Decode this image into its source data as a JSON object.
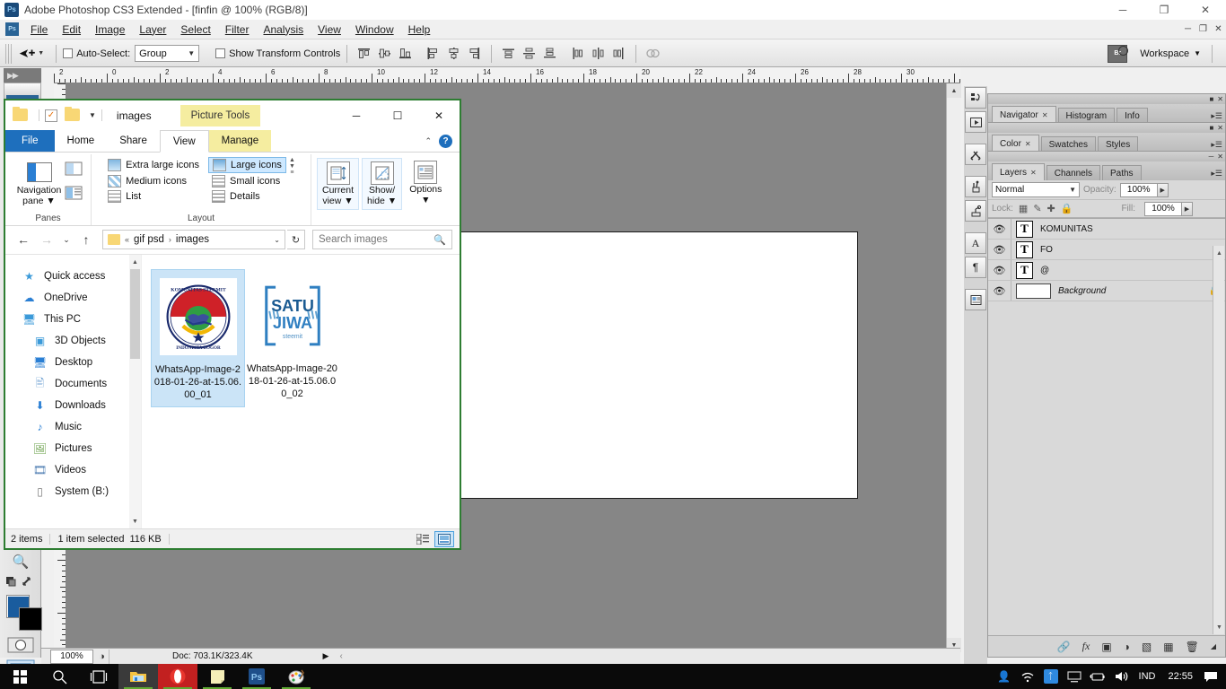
{
  "photoshop": {
    "title": "Adobe Photoshop CS3 Extended - [finfin @ 100% (RGB/8)]",
    "app_icon": "photoshop-icon",
    "window_buttons": {
      "minimize": "─",
      "maximize": "❐",
      "close": "✕"
    },
    "doc_buttons": {
      "minimize": "─",
      "restore": "❐",
      "close": "✕"
    },
    "menu": [
      {
        "label": "File"
      },
      {
        "label": "Edit"
      },
      {
        "label": "Image"
      },
      {
        "label": "Layer"
      },
      {
        "label": "Select"
      },
      {
        "label": "Filter"
      },
      {
        "label": "Analysis"
      },
      {
        "label": "View"
      },
      {
        "label": "Window"
      },
      {
        "label": "Help"
      }
    ],
    "options_bar": {
      "tool_icon": "move-tool-icon",
      "auto_select_label": "Auto-Select:",
      "auto_select_value": "Group",
      "show_transform_label": "Show Transform Controls",
      "align_icons": [
        "align-top-edges-icon",
        "align-vertical-centers-icon",
        "align-bottom-edges-icon",
        "align-left-edges-icon",
        "align-horizontal-centers-icon",
        "align-right-edges-icon"
      ],
      "distribute_icons": [
        "distribute-top-edges-icon",
        "distribute-vertical-centers-icon",
        "distribute-bottom-edges-icon",
        "distribute-left-edges-icon",
        "distribute-horizontal-centers-icon",
        "distribute-right-edges-icon",
        "distribute-link-icon"
      ],
      "bridge_label": "Br",
      "workspace_label": "Workspace"
    },
    "ruler": {
      "unit_marks": [
        "2",
        "0",
        "2",
        "4",
        "6",
        "8",
        "10",
        "12",
        "14",
        "16",
        "18",
        "20",
        "22",
        "24",
        "26",
        "28",
        "30"
      ]
    },
    "toolbox": {
      "zoom_tool": "zoom-tool-icon",
      "quickmask_tool": "quick-mask-icon",
      "foreground_color": "#1a5c9e",
      "background_color": "#000000",
      "screen_mode": "screen-mode-icon"
    },
    "status_bar": {
      "zoom": "100%",
      "doc_info": "Doc: 703.1K/323.4K"
    },
    "dock_icons": [
      "history-icon",
      "actions-icon",
      "tool-presets-icon",
      "brushes-icon",
      "clone-source-icon",
      "character-icon",
      "paragraph-icon",
      "layer-comps-icon"
    ],
    "panels": {
      "navigator_group": {
        "tabs": [
          {
            "label": "Navigator",
            "closable": true,
            "active": true
          },
          {
            "label": "Histogram",
            "closable": false,
            "active": false
          },
          {
            "label": "Info",
            "closable": false,
            "active": false
          }
        ]
      },
      "color_group": {
        "tabs": [
          {
            "label": "Color",
            "closable": true,
            "active": true
          },
          {
            "label": "Swatches",
            "closable": false,
            "active": false
          },
          {
            "label": "Styles",
            "closable": false,
            "active": false
          }
        ]
      },
      "layers_group": {
        "tabs": [
          {
            "label": "Layers",
            "closable": true,
            "active": true
          },
          {
            "label": "Channels",
            "closable": false,
            "active": false
          },
          {
            "label": "Paths",
            "closable": false,
            "active": false
          }
        ],
        "blend_mode": "Normal",
        "opacity_label": "Opacity:",
        "opacity_value": "100%",
        "lock_label": "Lock:",
        "lock_icons": [
          "lock-transparent-pixels-icon",
          "lock-image-pixels-icon",
          "lock-position-icon",
          "lock-all-icon"
        ],
        "fill_label": "Fill:",
        "fill_value": "100%",
        "layers": [
          {
            "name": "KOMUNITAS",
            "type": "text",
            "thumb": "T",
            "visible": true,
            "locked": false
          },
          {
            "name": "FO",
            "type": "text",
            "thumb": "T",
            "visible": true,
            "locked": false
          },
          {
            "name": "@",
            "type": "text",
            "thumb": "T",
            "visible": true,
            "locked": false
          },
          {
            "name": "Background",
            "type": "image",
            "thumb": "",
            "visible": true,
            "locked": true
          }
        ],
        "bottom_icons": [
          "link-layers-icon",
          "layer-style-icon",
          "layer-mask-icon",
          "adjustment-layer-icon",
          "new-group-icon",
          "new-layer-icon",
          "delete-layer-icon"
        ]
      }
    }
  },
  "explorer": {
    "window_title": "images",
    "quick_access_icons": [
      "folder-icon",
      "properties-icon",
      "new-folder-icon",
      "customize-caret-icon"
    ],
    "contextual_tab_group": "Picture Tools",
    "window_buttons": {
      "minimize": "─",
      "maximize": "☐",
      "close": "✕"
    },
    "tabs": [
      {
        "label": "File",
        "kind": "file"
      },
      {
        "label": "Home",
        "kind": "normal"
      },
      {
        "label": "Share",
        "kind": "normal"
      },
      {
        "label": "View",
        "kind": "active"
      },
      {
        "label": "Manage",
        "kind": "contextual"
      }
    ],
    "ribbon_collapse": "⌃",
    "help_label": "?",
    "ribbon": {
      "groups": [
        {
          "name": "Panes",
          "label": "Panes",
          "big_button": {
            "label_line1": "Navigation",
            "label_line2": "pane",
            "icon": "navigation-pane-icon",
            "has_caret": true
          },
          "small_buttons": [
            "preview-pane-icon",
            "details-pane-icon"
          ]
        },
        {
          "name": "Layout",
          "label": "Layout",
          "items": [
            {
              "label": "Extra large icons",
              "selected": false,
              "icon": "extra-large-icons-icon"
            },
            {
              "label": "Large icons",
              "selected": true,
              "icon": "large-icons-icon"
            },
            {
              "label": "Medium icons",
              "selected": false,
              "icon": "medium-icons-icon"
            },
            {
              "label": "Small icons",
              "selected": false,
              "icon": "small-icons-icon"
            },
            {
              "label": "List",
              "selected": false,
              "icon": "list-view-icon"
            },
            {
              "label": "Details",
              "selected": false,
              "icon": "details-view-icon"
            }
          ],
          "scroll": {
            "up": "▲",
            "down": "▼",
            "more": "☰"
          }
        },
        {
          "name": "CurrentView",
          "label": "",
          "commands": [
            {
              "label_line1": "Current",
              "label_line2": "view",
              "icon": "current-view-icon",
              "has_caret": true
            },
            {
              "label_line1": "Show/",
              "label_line2": "hide",
              "icon": "show-hide-icon",
              "has_caret": true
            },
            {
              "label_line1": "Options",
              "label_line2": "",
              "icon": "options-icon",
              "has_caret": true
            }
          ]
        }
      ]
    },
    "address_bar": {
      "back": "←",
      "forward": "→",
      "recent": "⌄",
      "up": "↑",
      "breadcrumb_root": "«",
      "breadcrumbs": [
        "gif psd",
        "images"
      ],
      "breadcrumb_sep": "›",
      "dropdown": "⌄",
      "refresh": "↻",
      "search_placeholder": "Search images",
      "search_value": "",
      "search_icon": "search-icon"
    },
    "nav_pane": [
      {
        "label": "Quick access",
        "icon": "star-pin-icon",
        "indent": false
      },
      {
        "label": "OneDrive",
        "icon": "onedrive-cloud-icon",
        "indent": false
      },
      {
        "label": "This PC",
        "icon": "this-pc-icon",
        "indent": false
      },
      {
        "label": "3D Objects",
        "icon": "3d-objects-icon",
        "indent": true
      },
      {
        "label": "Desktop",
        "icon": "desktop-icon",
        "indent": true
      },
      {
        "label": "Documents",
        "icon": "documents-icon",
        "indent": true
      },
      {
        "label": "Downloads",
        "icon": "downloads-icon",
        "indent": true
      },
      {
        "label": "Music",
        "icon": "music-icon",
        "indent": true
      },
      {
        "label": "Pictures",
        "icon": "pictures-icon",
        "indent": true
      },
      {
        "label": "Videos",
        "icon": "videos-icon",
        "indent": true
      },
      {
        "label": "System (B:)",
        "icon": "drive-icon",
        "indent": true
      }
    ],
    "files": [
      {
        "name": "WhatsApp-Image-2018-01-26-at-15.06.00_01",
        "selected": true,
        "thumb_kind": "komunitas-steemit-logo",
        "thumb_text_top": "KOMUNITAS STEEMIT INDONESIA BOGOR"
      },
      {
        "name": "WhatsApp-Image-2018-01-26-at-15.06.00_02",
        "selected": false,
        "thumb_kind": "satu-jiwa-logo",
        "thumb_line1": "SATU",
        "thumb_line2": "JIWA",
        "thumb_line3": "steemit"
      }
    ],
    "status": {
      "item_count": "2 items",
      "selection": "1 item selected",
      "size": "116 KB",
      "view_buttons": [
        {
          "icon": "details-view-button",
          "active": false
        },
        {
          "icon": "large-icons-view-button",
          "active": true
        }
      ]
    }
  },
  "taskbar": {
    "start": "start-button",
    "search": "search-icon",
    "taskview": "task-view-icon",
    "apps": [
      {
        "name": "file-explorer",
        "running": true,
        "active": true
      },
      {
        "name": "opera-browser",
        "running": true,
        "active": false
      },
      {
        "name": "sticky-notes",
        "running": true,
        "active": false
      },
      {
        "name": "adobe-photoshop",
        "running": true,
        "active": false
      },
      {
        "name": "paint",
        "running": true,
        "active": false
      }
    ],
    "tray": {
      "icons": [
        "people-icon",
        "wifi-icon",
        "bluetooth-icon",
        "display-icon",
        "battery-icon",
        "volume-icon"
      ],
      "language": "IND",
      "clock": "22:55",
      "action_center": "notifications-icon"
    }
  },
  "colors": {
    "accent_blue": "#1e6fbd",
    "selection_blue": "#cbe4f7",
    "explorer_border_green": "#2e7d32",
    "contextual_yellow": "#f5eda0",
    "taskbar_black": "#0a0a0a"
  }
}
